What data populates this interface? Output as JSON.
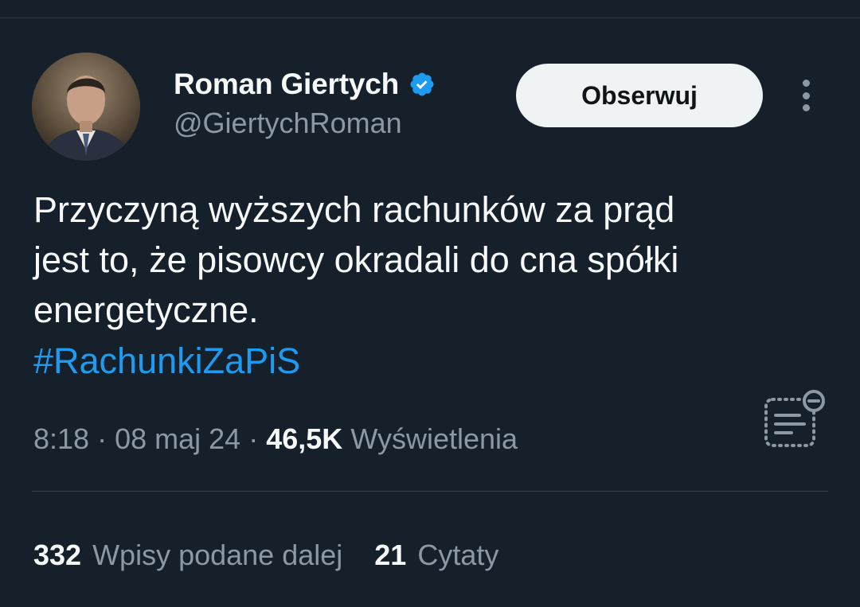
{
  "author": {
    "display_name": "Roman Giertych",
    "handle": "@GiertychRoman",
    "verified": true
  },
  "header": {
    "follow_label": "Obserwuj"
  },
  "tweet": {
    "text_lines": [
      "Przyczyną wyższych rachunków za prąd",
      "jest to, że pisowcy okradali do cna spółki",
      "energetyczne."
    ],
    "hashtag": "#RachunkiZaPiS"
  },
  "meta": {
    "time": "8:18",
    "separator1": "·",
    "date": "08 maj 24",
    "separator2": "·",
    "views_count": "46,5K",
    "views_label": "Wyświetlenia"
  },
  "stats": {
    "retweets_count": "332",
    "retweets_label": "Wpisy podane dalej",
    "quotes_count": "21",
    "quotes_label": "Cytaty"
  },
  "colors": {
    "background": "#15202b",
    "text_primary": "#f7f9f9",
    "text_secondary": "#8b98a5",
    "accent": "#1d9bf0",
    "verified_badge": "#1d9bf0",
    "button_bg": "#eff3f4"
  },
  "icons": {
    "verified": "verified-badge-icon",
    "more": "more-vertical-icon",
    "notes": "community-notes-icon"
  }
}
